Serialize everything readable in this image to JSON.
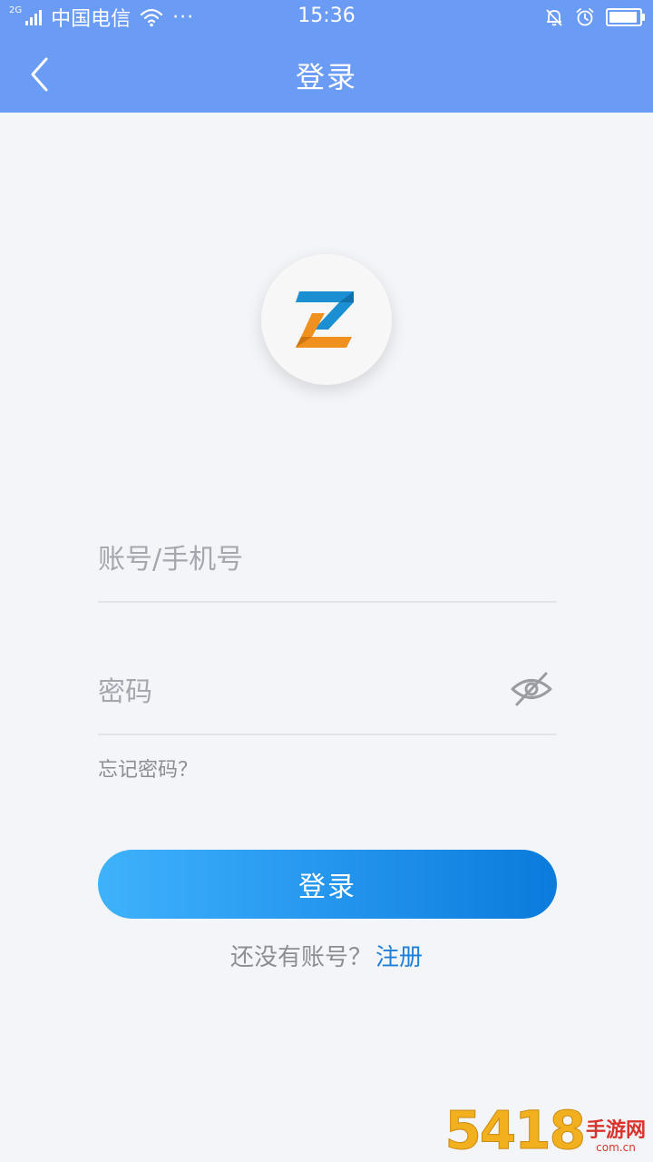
{
  "status_bar": {
    "network_type": "2G",
    "carrier": "中国电信",
    "more": "···",
    "time": "15:36",
    "battery_level": 0.95
  },
  "nav": {
    "title": "登录"
  },
  "form": {
    "account_placeholder": "账号/手机号",
    "password_placeholder": "密码",
    "forgot_password": "忘记密码？",
    "login_button": "登录",
    "no_account_text": "还没有账号？",
    "register_link": "注册"
  },
  "watermark": {
    "digits": "5418",
    "text": "手游网",
    "domain": "com.cn"
  },
  "colors": {
    "header": "#6b9cf5",
    "button_gradient_start": "#3fb2fb",
    "button_gradient_end": "#0b7bdc",
    "link": "#1f7fd6",
    "logo_blue": "#1b8fd2",
    "logo_orange": "#f0901e"
  },
  "icons": {
    "back": "chevron-left-icon",
    "wifi": "wifi-icon",
    "signal": "signal-icon",
    "mute": "bell-off-icon",
    "alarm": "alarm-icon",
    "battery": "battery-icon",
    "password_toggle": "eye-off-icon",
    "logo": "z-logo-icon"
  }
}
